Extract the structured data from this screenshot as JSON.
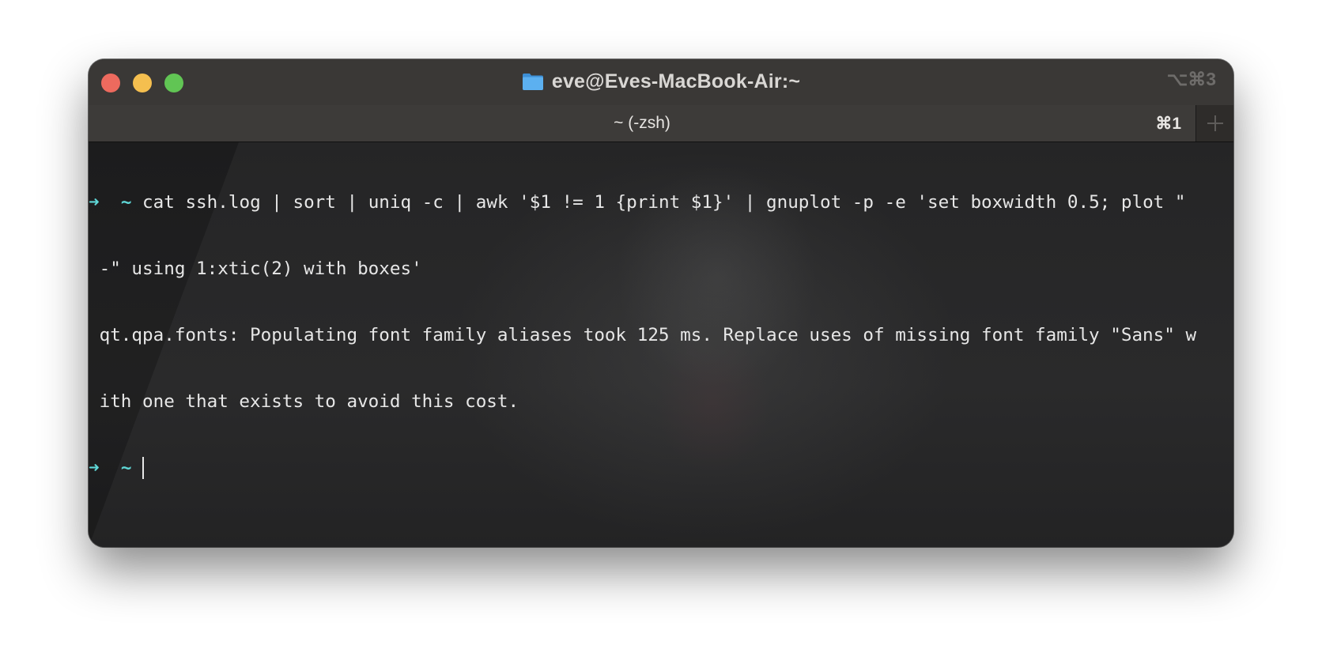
{
  "window": {
    "title": "eve@Eves-MacBook-Air:~",
    "title_shortcut": "⌥⌘3"
  },
  "tab": {
    "label": "~ (-zsh)",
    "shortcut": "⌘1"
  },
  "terminal": {
    "prompt_arrow": "➜",
    "prompt_dir": "~",
    "command_line_1": " cat ssh.log | sort | uniq -c | awk '$1 != 1 {print $1}' | gnuplot -p -e 'set boxwidth 0.5; plot \"",
    "command_line_2": " -\" using 1:xtic(2) with boxes'",
    "output_line_1": " qt.qpa.fonts: Populating font family aliases took 125 ms. Replace uses of missing font family \"Sans\" w",
    "output_line_2": " ith one that exists to avoid this cost."
  },
  "colors": {
    "prompt": "#5fd7d7",
    "titlebar": "#3a3836",
    "close": "#ed6a5e",
    "minimize": "#f5bf4f",
    "zoom": "#61c554",
    "folder": "#4fa3e8"
  },
  "icons": [
    "folder-icon",
    "plus-icon"
  ]
}
